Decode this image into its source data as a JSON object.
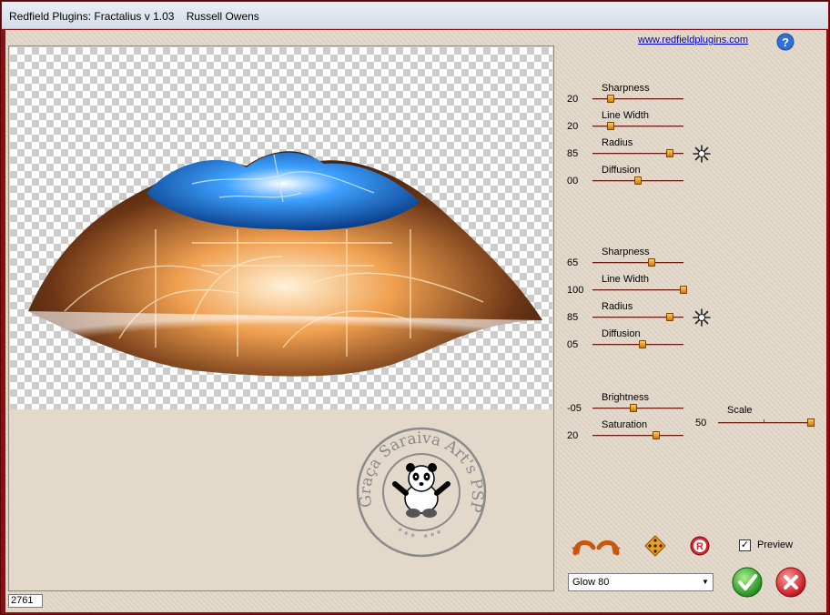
{
  "window": {
    "title": "Redfield Plugins: Fractalius v 1.03    Russell Owens"
  },
  "header": {
    "link_text": "www.redfieldplugins.com",
    "help_icon": "help-icon"
  },
  "group1": {
    "sliders": [
      {
        "label": "Sharpness",
        "value": "20",
        "level": 0.2
      },
      {
        "label": "Line Width",
        "value": "20",
        "level": 0.2
      },
      {
        "label": "Radius",
        "value": "85",
        "level": 0.85
      },
      {
        "label": "Diffusion",
        "value": "00",
        "level": 0.5
      }
    ],
    "star_icon": "starburst-icon"
  },
  "group2": {
    "sliders": [
      {
        "label": "Sharpness",
        "value": "65",
        "level": 0.65
      },
      {
        "label": "Line Width",
        "value": "100",
        "level": 1.0
      },
      {
        "label": "Radius",
        "value": "85",
        "level": 0.85
      },
      {
        "label": "Diffusion",
        "value": "05",
        "level": 0.55
      }
    ],
    "star_icon": "starburst-icon"
  },
  "group3": {
    "sliders": [
      {
        "label": "Brightness",
        "value": "-05",
        "level": 0.45
      },
      {
        "label": "Saturation",
        "value": "20",
        "level": 0.7
      }
    ],
    "scale": {
      "label": "Scale",
      "value": "50",
      "level": 1.0
    }
  },
  "preview_pane": {
    "status_value": "2761",
    "stamp_text": "Graça Saraiva Art's PSP",
    "stamp_stars": "*** ***"
  },
  "controls": {
    "preview_label": "Preview",
    "preview_checked": "✓",
    "preset_value": "Glow 80",
    "preset_arrow": "▼",
    "ok_icon": "checkmark-icon",
    "cancel_icon": "close-icon"
  },
  "colors": {
    "frame": "#8b0f12",
    "panel": "#e3d9ca",
    "thumb": "#f0a020",
    "track": "#6b1a12",
    "link": "#0000cc"
  }
}
